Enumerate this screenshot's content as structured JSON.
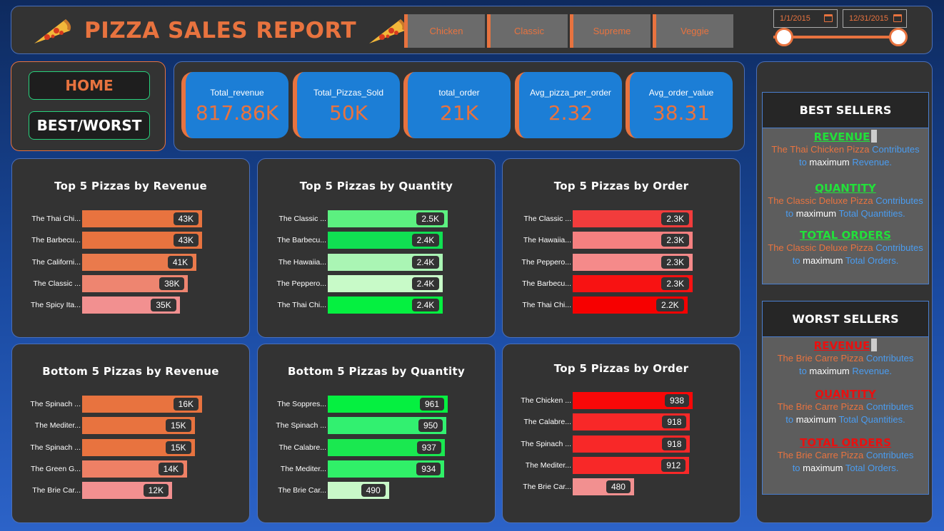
{
  "header": {
    "title": "PIZZA SALES REPORT",
    "categories": [
      "Chicken",
      "Classic",
      "Supreme",
      "Veggie"
    ],
    "date_start": "1/1/2015",
    "date_end": "12/31/2015"
  },
  "nav": {
    "home": "HOME",
    "best_worst": "BEST/WORST"
  },
  "kpis": [
    {
      "label": "Total_revenue",
      "value": "817.86K"
    },
    {
      "label": "Total_Pizzas_Sold",
      "value": "50K"
    },
    {
      "label": "total_order",
      "value": "21K"
    },
    {
      "label": "Avg_pizza_per_order",
      "value": "2.32"
    },
    {
      "label": "Avg_order_value",
      "value": "38.31"
    }
  ],
  "chart_data": [
    {
      "type": "bar",
      "orientation": "horizontal",
      "title": "Top 5 Pizzas by Revenue",
      "categories": [
        "The Thai Chi...",
        "The Barbecu...",
        "The Californi...",
        "The Classic ...",
        "The Spicy Ita..."
      ],
      "values": [
        43000,
        43000,
        41000,
        38000,
        35000
      ],
      "labels": [
        "43K",
        "43K",
        "41K",
        "38K",
        "35K"
      ],
      "colors": [
        "#e8733f",
        "#e8733f",
        "#ea7a4c",
        "#ee8570",
        "#f29090"
      ]
    },
    {
      "type": "bar",
      "orientation": "horizontal",
      "title": "Top 5 Pizzas by Quantity",
      "categories": [
        "The Classic ...",
        "The Barbecu...",
        "The Hawaiia...",
        "The Peppero...",
        "The Thai Chi..."
      ],
      "values": [
        2500,
        2400,
        2400,
        2400,
        2400
      ],
      "labels": [
        "2.5K",
        "2.4K",
        "2.4K",
        "2.4K",
        "2.4K"
      ],
      "colors": [
        "#5cf080",
        "#10e052",
        "#aaf5b4",
        "#c8fac8",
        "#05f040"
      ]
    },
    {
      "type": "bar",
      "orientation": "horizontal",
      "title": "Top 5 Pizzas by Order",
      "categories": [
        "The Classic ...",
        "The Hawaiia...",
        "The Peppero...",
        "The Barbecu...",
        "The Thai Chi..."
      ],
      "values": [
        2300,
        2300,
        2300,
        2300,
        2200
      ],
      "labels": [
        "2.3K",
        "2.3K",
        "2.3K",
        "2.3K",
        "2.2K"
      ],
      "colors": [
        "#f23c3c",
        "#f58080",
        "#f58a8a",
        "#f81212",
        "#f70000"
      ]
    },
    {
      "type": "bar",
      "orientation": "horizontal",
      "title": "Bottom 5 Pizzas by Revenue",
      "categories": [
        "The Spinach ...",
        "The Mediter...",
        "The Spinach ...",
        "The Green G...",
        "The Brie Car..."
      ],
      "values": [
        16000,
        15000,
        15000,
        14000,
        12000
      ],
      "labels": [
        "16K",
        "15K",
        "15K",
        "14K",
        "12K"
      ],
      "colors": [
        "#e8733f",
        "#e8733f",
        "#e8733f",
        "#ee8065",
        "#f29090"
      ]
    },
    {
      "type": "bar",
      "orientation": "horizontal",
      "title": "Bottom 5 Pizzas by Quantity",
      "categories": [
        "The Soppres...",
        "The Spinach ...",
        "The Calabre...",
        "The Mediter...",
        "The Brie Car..."
      ],
      "values": [
        961,
        950,
        937,
        934,
        490
      ],
      "labels": [
        "961",
        "950",
        "937",
        "934",
        "490"
      ],
      "colors": [
        "#05f040",
        "#32f070",
        "#1ae850",
        "#30f068",
        "#c8f8c8"
      ]
    },
    {
      "type": "bar",
      "orientation": "horizontal",
      "title": "Top 5 Pizzas by Order",
      "categories": [
        "The Chicken ...",
        "The Calabre...",
        "The Spinach ...",
        "The Mediter...",
        "The Brie Car..."
      ],
      "values": [
        938,
        918,
        918,
        912,
        480
      ],
      "labels": [
        "938",
        "918",
        "918",
        "912",
        "480"
      ],
      "colors": [
        "#f80808",
        "#f82828",
        "#f82828",
        "#f82828",
        "#f29090"
      ]
    }
  ],
  "best": {
    "title": "BEST SELLERS",
    "sections": [
      {
        "head": "REVENUE",
        "pizza": "The Thai Chicken Pizza",
        "contrib": "Contributes",
        "to": "to",
        "max": "maximum",
        "metric": "Revenue."
      },
      {
        "head": "QUANTITY",
        "pizza": "The Classic Deluxe Pizza",
        "contrib": "Contributes",
        "to": "to",
        "max": "maximum",
        "metric": "Total Quantities."
      },
      {
        "head": "TOTAL ORDERS",
        "pizza": "The Classic Deluxe Pizza",
        "contrib": "Contributes",
        "to": "to",
        "max": "maximum",
        "metric": "Total Orders."
      }
    ]
  },
  "worst": {
    "title": "WORST SELLERS",
    "sections": [
      {
        "head": "REVENUE",
        "pizza": "The Brie Carre Pizza",
        "contrib": "Contributes",
        "to": "to",
        "max": "maximum",
        "metric": "Revenue."
      },
      {
        "head": "QUANTITY",
        "pizza": "The Brie Carre Pizza",
        "contrib": "Contributes",
        "to": "to",
        "max": "maximum",
        "metric": "Total Quantities."
      },
      {
        "head": "TOTAL ORDERS",
        "pizza": "The Brie Carre Pizza",
        "contrib": "Contributes",
        "to": "to",
        "max": "maximum",
        "metric": "Total Orders."
      }
    ]
  },
  "colors": {
    "accent": "#e8733f",
    "panel": "#333333",
    "kpi": "#1c7ed6",
    "best_head": "#22e03a",
    "worst_head": "#e81010"
  }
}
